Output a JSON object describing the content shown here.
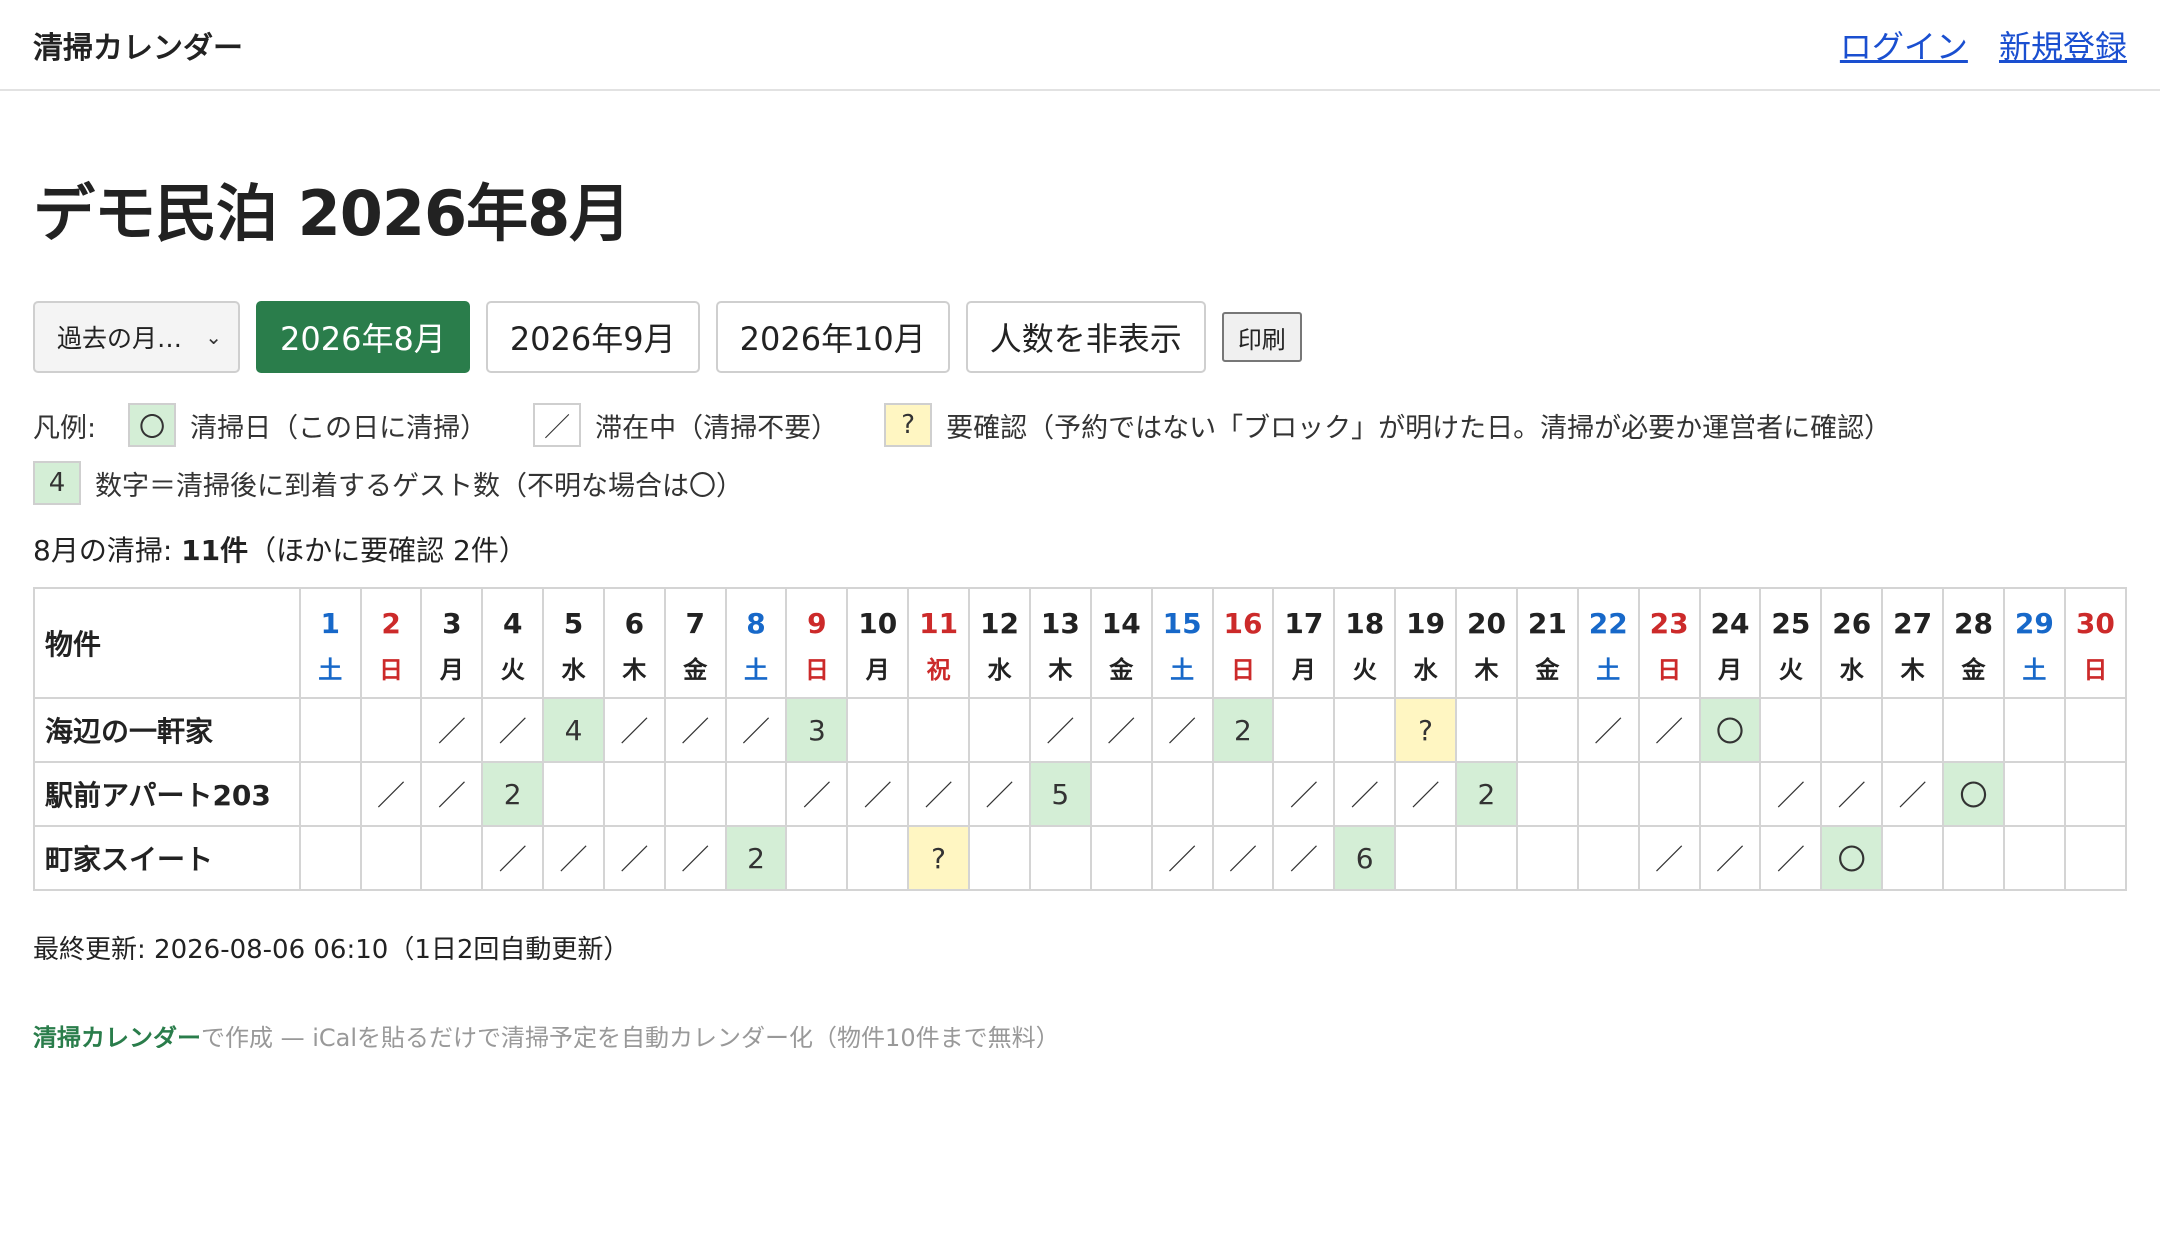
{
  "header": {
    "brand": "清掃カレンダー",
    "login": "ログイン",
    "signup": "新規登録"
  },
  "page_title": "デモ民泊 2026年8月",
  "controls": {
    "past_select": "過去の月…",
    "months": [
      "2026年8月",
      "2026年9月",
      "2026年10月"
    ],
    "active_month": 0,
    "hide_count": "人数を非表示",
    "print": "印刷"
  },
  "legend": {
    "label": "凡例:",
    "items": [
      {
        "symbol": "〇",
        "style": "green",
        "text": "清掃日（この日に清掃）"
      },
      {
        "symbol": "／",
        "style": "white",
        "text": "滞在中（清掃不要）"
      },
      {
        "symbol": "?",
        "style": "yellow",
        "text": "要確認（予約ではない「ブロック」が明けた日。清掃が必要か運営者に確認）"
      }
    ],
    "count_item": {
      "symbol": "4",
      "style": "green",
      "text": "数字＝清掃後に到着するゲスト数（不明な場合は〇）"
    }
  },
  "summary": {
    "prefix": "8月の清掃: ",
    "count": "11件",
    "suffix": "（ほかに要確認 2件）"
  },
  "table": {
    "property_header": "物件",
    "days": [
      {
        "d": "1",
        "w": "土",
        "t": "sat"
      },
      {
        "d": "2",
        "w": "日",
        "t": "sun"
      },
      {
        "d": "3",
        "w": "月",
        "t": ""
      },
      {
        "d": "4",
        "w": "火",
        "t": ""
      },
      {
        "d": "5",
        "w": "水",
        "t": ""
      },
      {
        "d": "6",
        "w": "木",
        "t": ""
      },
      {
        "d": "7",
        "w": "金",
        "t": ""
      },
      {
        "d": "8",
        "w": "土",
        "t": "sat"
      },
      {
        "d": "9",
        "w": "日",
        "t": "sun"
      },
      {
        "d": "10",
        "w": "月",
        "t": ""
      },
      {
        "d": "11",
        "w": "祝",
        "t": "sun"
      },
      {
        "d": "12",
        "w": "水",
        "t": ""
      },
      {
        "d": "13",
        "w": "木",
        "t": ""
      },
      {
        "d": "14",
        "w": "金",
        "t": ""
      },
      {
        "d": "15",
        "w": "土",
        "t": "sat"
      },
      {
        "d": "16",
        "w": "日",
        "t": "sun"
      },
      {
        "d": "17",
        "w": "月",
        "t": ""
      },
      {
        "d": "18",
        "w": "火",
        "t": ""
      },
      {
        "d": "19",
        "w": "水",
        "t": ""
      },
      {
        "d": "20",
        "w": "木",
        "t": ""
      },
      {
        "d": "21",
        "w": "金",
        "t": ""
      },
      {
        "d": "22",
        "w": "土",
        "t": "sat"
      },
      {
        "d": "23",
        "w": "日",
        "t": "sun"
      },
      {
        "d": "24",
        "w": "月",
        "t": ""
      },
      {
        "d": "25",
        "w": "火",
        "t": ""
      },
      {
        "d": "26",
        "w": "水",
        "t": ""
      },
      {
        "d": "27",
        "w": "木",
        "t": ""
      },
      {
        "d": "28",
        "w": "金",
        "t": ""
      },
      {
        "d": "29",
        "w": "土",
        "t": "sat"
      },
      {
        "d": "30",
        "w": "日",
        "t": "sun"
      }
    ],
    "rows": [
      {
        "name": "海辺の一軒家",
        "cells": [
          "",
          "",
          "／",
          "／",
          "4",
          "／",
          "／",
          "／",
          "3",
          "",
          "",
          "",
          "／",
          "／",
          "／",
          "2",
          "",
          "",
          "?",
          "",
          "",
          "／",
          "／",
          "〇",
          "",
          "",
          "",
          "",
          "",
          ""
        ]
      },
      {
        "name": "駅前アパート203",
        "cells": [
          "",
          "／",
          "／",
          "2",
          "",
          "",
          "",
          "",
          "／",
          "／",
          "／",
          "／",
          "5",
          "",
          "",
          "",
          "／",
          "／",
          "／",
          "2",
          "",
          "",
          "",
          "",
          "／",
          "／",
          "／",
          "〇",
          "",
          ""
        ]
      },
      {
        "name": "町家スイート",
        "cells": [
          "",
          "",
          "",
          "／",
          "／",
          "／",
          "／",
          "2",
          "",
          "",
          "?",
          "",
          "",
          "",
          "／",
          "／",
          "／",
          "6",
          "",
          "",
          "",
          "",
          "／",
          "／",
          "／",
          "〇",
          "",
          "",
          "",
          ""
        ]
      }
    ]
  },
  "footer": {
    "updated": "最終更新: 2026-08-06 06:10（1日2回自動更新）",
    "credit_link": "清掃カレンダー",
    "credit_text": "で作成 — iCalを貼るだけで清掃予定を自動カレンダー化（物件10件まで無料）"
  },
  "colors": {
    "clean": "#d4eed6",
    "check": "#fff6c2",
    "active_button": "#2a7d4b",
    "saturday": "#1768c9",
    "sunday": "#cc2a2a",
    "link": "#1a4fd0"
  }
}
